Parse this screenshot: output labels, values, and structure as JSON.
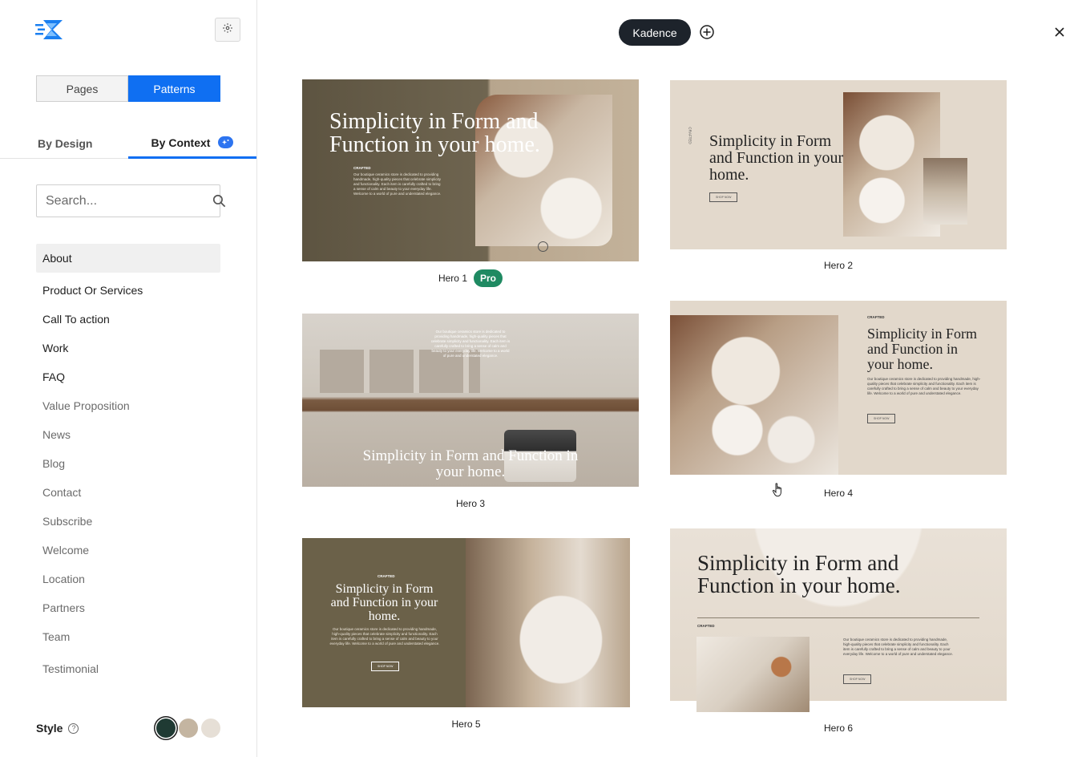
{
  "sidebar": {
    "mode_tabs": [
      "Pages",
      "Patterns"
    ],
    "active_mode": "Patterns",
    "context_tabs": [
      "By Design",
      "By Context"
    ],
    "active_context_tab": "By Context",
    "search": {
      "placeholder": "Search...",
      "value": ""
    },
    "categories": [
      {
        "label": "About",
        "selected": true
      },
      {
        "label": "Product Or Services"
      },
      {
        "label": "Call To action"
      },
      {
        "label": "Work"
      },
      {
        "label": "FAQ"
      },
      {
        "label": "Value Proposition"
      },
      {
        "label": "News"
      },
      {
        "label": "Blog"
      },
      {
        "label": "Contact"
      },
      {
        "label": "Subscribe"
      },
      {
        "label": "Welcome"
      },
      {
        "label": "Location"
      },
      {
        "label": "Partners"
      },
      {
        "label": "Team"
      },
      {
        "label": "Testimonial"
      }
    ],
    "style": {
      "label": "Style",
      "help": "?",
      "swatches": [
        "#1f3a33",
        "#c4b5a1",
        "#e6dfd6"
      ]
    }
  },
  "topbar": {
    "library_label": "Kadence"
  },
  "patterns": [
    {
      "label": "Hero 1",
      "badge": "Pro"
    },
    {
      "label": "Hero 2"
    },
    {
      "label": "Hero 3"
    },
    {
      "label": "Hero 4"
    },
    {
      "label": "Hero 5"
    },
    {
      "label": "Hero 6"
    }
  ],
  "preview_text": {
    "headline_a": "Simplicity in Form and",
    "headline_b": "Function in your home.",
    "headline_full": "Simplicity in Form and Function in your home.",
    "eyebrow": "CRAFTED",
    "body": "Our boutique ceramics store is dedicated to providing handmade, high-quality pieces that celebrate simplicity and functionality. Each item is carefully crafted to bring a sense of calm and beauty to your everyday life. Welcome to a world of pure and understated elegance.",
    "cta": "SHOP NOW"
  },
  "colors": {
    "accent": "#0f6ff2",
    "pro_badge": "#1f8a62",
    "olive": "#6b6149",
    "sand": "#e2d8cb"
  }
}
